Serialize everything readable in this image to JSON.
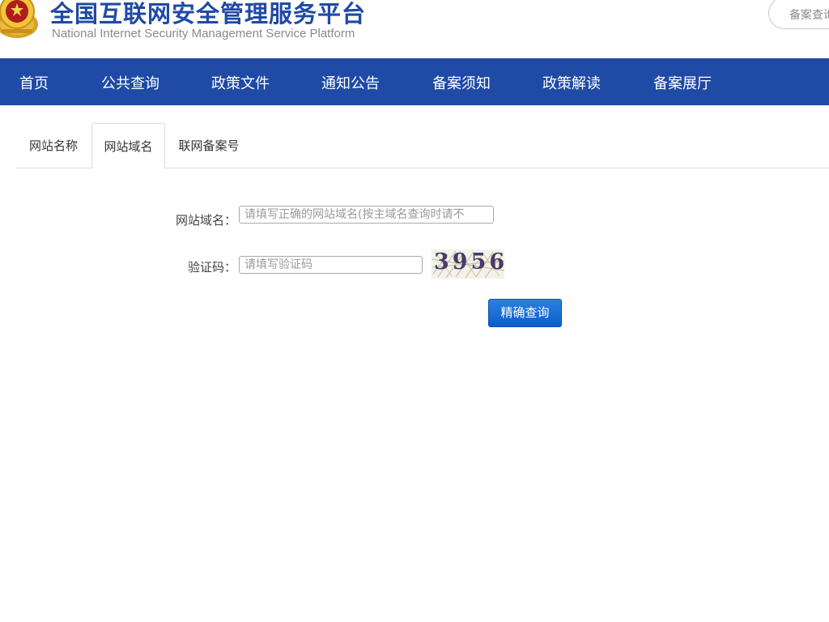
{
  "header": {
    "title": "全国互联网安全管理服务平台",
    "subtitle": "National Internet Security Management Service Platform",
    "top_search_label": "备案查询"
  },
  "nav": {
    "items": [
      {
        "label": "首页"
      },
      {
        "label": "公共查询"
      },
      {
        "label": "政策文件"
      },
      {
        "label": "通知公告"
      },
      {
        "label": "备案须知"
      },
      {
        "label": "政策解读"
      },
      {
        "label": "备案展厅"
      }
    ]
  },
  "tabs": [
    {
      "label": "网站名称",
      "active": false
    },
    {
      "label": "网站域名",
      "active": true
    },
    {
      "label": "联网备案号",
      "active": false
    }
  ],
  "form": {
    "domain_label": "网站域名：",
    "domain_placeholder": "请填写正确的网站域名(按主域名查询时请不",
    "domain_value": "",
    "captcha_label": "验证码：",
    "captcha_placeholder": "请填写验证码",
    "captcha_value": "",
    "captcha_code": "3956",
    "submit_label": "精确查询"
  },
  "colors": {
    "brand_blue": "#1f4aa5",
    "button_blue": "#0b5fc9"
  }
}
